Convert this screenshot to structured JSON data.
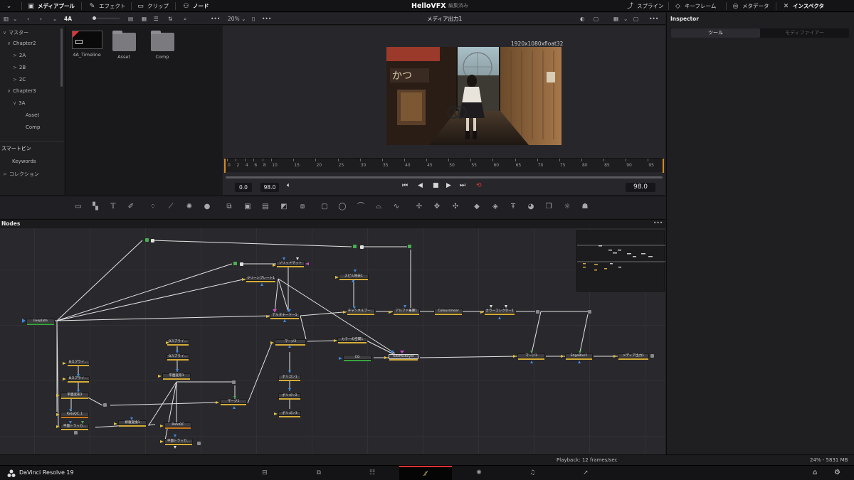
{
  "topbar": {
    "menu_icon": "chevron-down-icon",
    "media_pool": "メディアプール",
    "effects": "エフェクト",
    "clips": "クリップ",
    "nodes": "ノード",
    "project_title": "HelloVFX",
    "project_status": "編集済み",
    "spline": "スプライン",
    "keyframes": "キーフレーム",
    "metadata": "メタデータ",
    "inspector": "インスペクタ"
  },
  "subbar": {
    "folder_name": "4A",
    "zoom": "20%",
    "viewer_title": "メディア出力1"
  },
  "media_tree": {
    "items": [
      {
        "label": "マスター",
        "level": 0
      },
      {
        "label": "Chapter2",
        "level": 1
      },
      {
        "label": "2A",
        "level": 2
      },
      {
        "label": "2B",
        "level": 2
      },
      {
        "label": "2C",
        "level": 2
      },
      {
        "label": "Chapter3",
        "level": 1
      },
      {
        "label": "3A",
        "level": 2
      },
      {
        "label": "Asset",
        "level": 3
      },
      {
        "label": "Comp",
        "level": 3
      }
    ],
    "smart_bins_title": "スマートビン",
    "smart_bin_keywords": "Keywords",
    "smart_bin_collections": "コレクション"
  },
  "bins": [
    {
      "label": "4A_Timeline",
      "kind": "timeline"
    },
    {
      "label": "Asset",
      "kind": "folder"
    },
    {
      "label": "Comp",
      "kind": "folder"
    }
  ],
  "viewer": {
    "resolution": "1920x1080xfloat32",
    "ruler_ticks": [
      "0",
      "2",
      "4",
      "6",
      "8",
      "10",
      "15",
      "20",
      "25",
      "30",
      "35",
      "40",
      "45",
      "50",
      "55",
      "60",
      "65",
      "70",
      "75",
      "80",
      "85",
      "90",
      "95"
    ],
    "in_point": "0.0",
    "out_point": "98.0",
    "current_frame": "98.0"
  },
  "inspector": {
    "title": "Inspector",
    "tab_tools": "ツール",
    "tab_modifiers": "モディファイアー"
  },
  "nodes_panel": {
    "title": "Nodes",
    "nodes": [
      {
        "id": "n_liveplate",
        "label": "liveplate"
      },
      {
        "id": "n_solid",
        "label": "ソリッドマット"
      },
      {
        "id": "n_clean",
        "label": "クリーンプレート1"
      },
      {
        "id": "n_spill",
        "label": "スピル除去1"
      },
      {
        "id": "n_delta",
        "label": "デルタキーヤー1"
      },
      {
        "id": "n_channel",
        "label": "チャンネルブー…"
      },
      {
        "id": "n_alpha",
        "label": "アルファ乗算1"
      },
      {
        "id": "n_smear",
        "label": "Coloursmear"
      },
      {
        "id": "n_cc",
        "label": "カラーコレクター1"
      },
      {
        "id": "n_merge2",
        "label": "マージ2"
      },
      {
        "id": "n_cspace",
        "label": "カラーの空間1"
      },
      {
        "id": "n_cg",
        "label": "CG"
      },
      {
        "id": "n_addkey",
        "label": "AddMixKeyer"
      },
      {
        "id": "n_merge3",
        "label": "マージ3"
      },
      {
        "id": "n_edge",
        "label": "EdgeBlur1"
      },
      {
        "id": "n_out",
        "label": "メディア出力1"
      },
      {
        "id": "n_poly1",
        "label": "ポリゴン1"
      },
      {
        "id": "n_poly2",
        "label": "ポリゴン2"
      },
      {
        "id": "n_poly3",
        "label": "ポリゴン3"
      },
      {
        "id": "n_bspline1",
        "label": "Bスプライ…"
      },
      {
        "id": "n_bspline2",
        "label": "Bスプライ…"
      },
      {
        "id": "n_plane1",
        "label": "平面変形1"
      },
      {
        "id": "n_bspline3",
        "label": "Bスプライ…"
      },
      {
        "id": "n_bspline4",
        "label": "Bスプライ…"
      },
      {
        "id": "n_plane2",
        "label": "平面変形2"
      },
      {
        "id": "n_merge1",
        "label": "マージ1"
      },
      {
        "id": "n_rotoqc1",
        "label": "RotoQC_1"
      },
      {
        "id": "n_track1",
        "label": "平面トラッカ…"
      },
      {
        "id": "n_restore",
        "label": "修復変換1"
      },
      {
        "id": "n_rotoqc2",
        "label": "RotoQC"
      },
      {
        "id": "n_track2",
        "label": "平面トラッカ…"
      }
    ]
  },
  "status": {
    "playback": "Playback: 12 frames/sec",
    "memory": "24% - 5831 MB"
  },
  "bottombar": {
    "app_name": "DaVinci Resolve 19",
    "page_icons": [
      "media-page-icon",
      "cut-page-icon",
      "edit-page-icon",
      "fusion-page-icon",
      "color-page-icon",
      "fairlight-page-icon",
      "deliver-page-icon"
    ],
    "active_page": "fusion-page-icon"
  },
  "colors": {
    "accent_red": "#e03434",
    "node_yellow": "#d4ac38",
    "node_green": "#49b04f",
    "fusion_tab_accent": "#e7d36a"
  }
}
